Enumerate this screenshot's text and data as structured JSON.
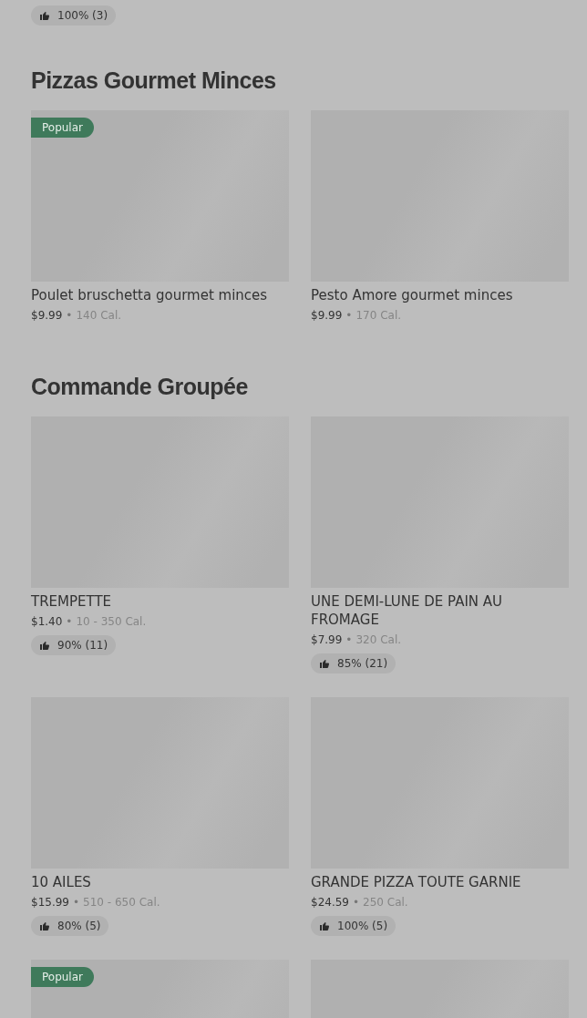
{
  "top_rating": "100% (3)",
  "sections": [
    {
      "title": "Pizzas Gourmet Minces",
      "items": [
        {
          "kind": "product",
          "badge": "Popular",
          "name": "Poulet bruschetta gourmet minces",
          "price": "$9.99",
          "separator": "•",
          "calories": "140 Cal."
        },
        {
          "kind": "product",
          "name": "Pesto Amore gourmet minces",
          "price": "$9.99",
          "separator": "•",
          "calories": "170 Cal."
        }
      ]
    },
    {
      "title": "Commande Groupée",
      "items": [
        {
          "kind": "product",
          "name": "TREMPETTE",
          "price": "$1.40",
          "separator": "•",
          "calories": "10 - 350 Cal.",
          "rating": "90% (11)"
        },
        {
          "kind": "product",
          "name": "UNE DEMI-LUNE DE PAIN AU FROMAGE",
          "price": "$7.99",
          "separator": "•",
          "calories": "320 Cal.",
          "rating": "85% (21)"
        },
        {
          "kind": "product",
          "name": "10 AILES",
          "price": "$15.99",
          "separator": "•",
          "calories": "510 - 650 Cal.",
          "rating": "80% (5)"
        },
        {
          "kind": "product",
          "name": "GRANDE PIZZA TOUTE GARNIE",
          "price": "$24.59",
          "separator": "•",
          "calories": "250 Cal.",
          "rating": "100% (5)"
        },
        {
          "kind": "image_only",
          "badge": "Popular"
        },
        {
          "kind": "image_only"
        }
      ]
    }
  ]
}
